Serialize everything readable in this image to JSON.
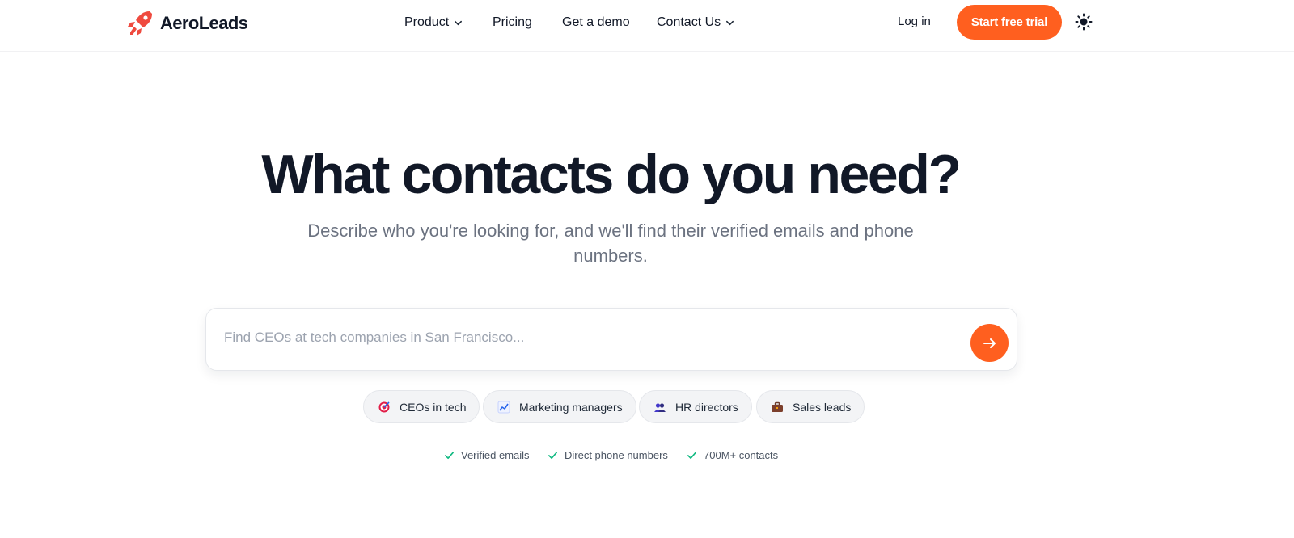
{
  "brand": {
    "name": "AeroLeads",
    "accent": "#ff5f1f",
    "logo_icon": "rocket-icon"
  },
  "nav": {
    "items": [
      {
        "label": "Product",
        "has_dropdown": true
      },
      {
        "label": "Pricing",
        "has_dropdown": false
      },
      {
        "label": "Get a demo",
        "has_dropdown": false
      },
      {
        "label": "Contact Us",
        "has_dropdown": true
      }
    ],
    "login": "Log in",
    "cta": "Start free trial",
    "theme_icon": "sun-icon"
  },
  "hero": {
    "title": "What contacts do you need?",
    "subtitle": "Describe who you're looking for, and we'll find their verified emails and phone numbers."
  },
  "search": {
    "value": "",
    "placeholder": "Find CEOs at tech companies in San Francisco...",
    "submit_icon": "arrow-right-icon"
  },
  "chips": [
    {
      "label": "CEOs in tech",
      "icon": "target-icon"
    },
    {
      "label": "Marketing managers",
      "icon": "chart-increasing-icon"
    },
    {
      "label": "HR directors",
      "icon": "people-icon"
    },
    {
      "label": "Sales leads",
      "icon": "briefcase-icon"
    }
  ],
  "features": [
    {
      "label": "Verified emails",
      "icon": "check-icon"
    },
    {
      "label": "Direct phone numbers",
      "icon": "check-icon"
    },
    {
      "label": "700M+ contacts",
      "icon": "check-icon"
    }
  ],
  "colors": {
    "check": "#10b981",
    "text_dark": "#111827",
    "text_muted": "#6b7280"
  }
}
